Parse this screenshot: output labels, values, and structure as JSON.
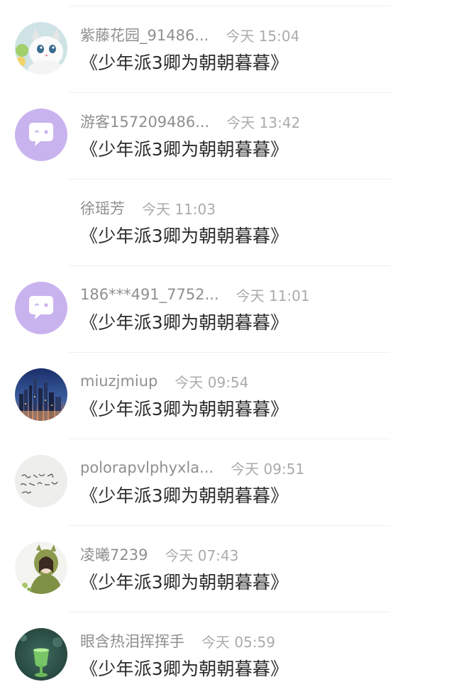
{
  "messages": [
    {
      "username": "紫藤花园_91486...",
      "time": "今天 15:04",
      "text": "《少年派3卿为朝朝暮暮》",
      "avatar": "cat-photo-avatar"
    },
    {
      "username": "游客157209486...",
      "time": "今天 13:42",
      "text": "《少年派3卿为朝朝暮暮》",
      "avatar": "default-chat-avatar"
    },
    {
      "username": "徐瑶芳",
      "time": "今天 11:03",
      "text": "《少年派3卿为朝朝暮暮》",
      "avatar": "none"
    },
    {
      "username": "186***491_7752...",
      "time": "今天 11:01",
      "text": "《少年派3卿为朝朝暮暮》",
      "avatar": "default-chat-avatar"
    },
    {
      "username": "miuzjmiup",
      "time": "今天 09:54",
      "text": "《少年派3卿为朝朝暮暮》",
      "avatar": "city-skyline-avatar"
    },
    {
      "username": "polorapvlphyxla...",
      "time": "今天 09:51",
      "text": "《少年派3卿为朝朝暮暮》",
      "avatar": "handwriting-avatar"
    },
    {
      "username": "凌曦7239",
      "time": "今天 07:43",
      "text": "《少年派3卿为朝朝暮暮》",
      "avatar": "girl-hood-avatar"
    },
    {
      "username": "眼含热泪挥挥手",
      "time": "今天 05:59",
      "text": "《少年派3卿为朝朝暮暮》",
      "avatar": "green-glass-avatar"
    }
  ],
  "colors": {
    "default_avatar_bg": "#c9b3ef",
    "username": "#8f8f8f",
    "time": "#ababab",
    "message": "#2b2b2b"
  }
}
